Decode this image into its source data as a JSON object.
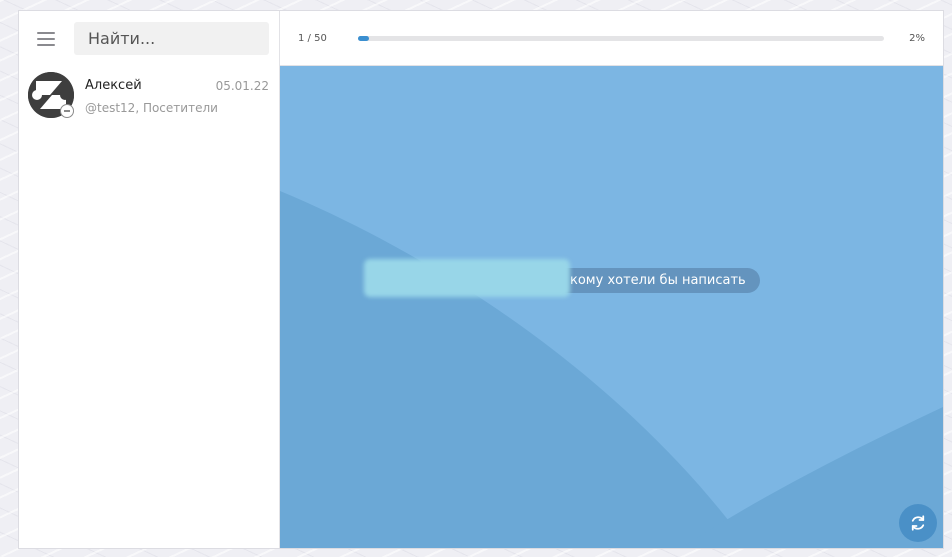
{
  "sidebar": {
    "search_placeholder": "Найти...",
    "chats": [
      {
        "name": "Алексей",
        "date": "05.01.22",
        "subtitle": "@test12, Посетители",
        "status": "offline"
      }
    ]
  },
  "topbar": {
    "page_count": "1 / 50",
    "progress": 0.02,
    "percent_label": "2%"
  },
  "chat_area": {
    "hint_text": "кому хотели бы написать",
    "background_color": "#7cb6e3",
    "accent_color": "#3b8fd0"
  },
  "icons": {
    "menu": "hamburger-menu-icon",
    "refresh": "refresh-icon",
    "avatar_logo": "z-logo-icon",
    "status": "minus-status-icon"
  }
}
